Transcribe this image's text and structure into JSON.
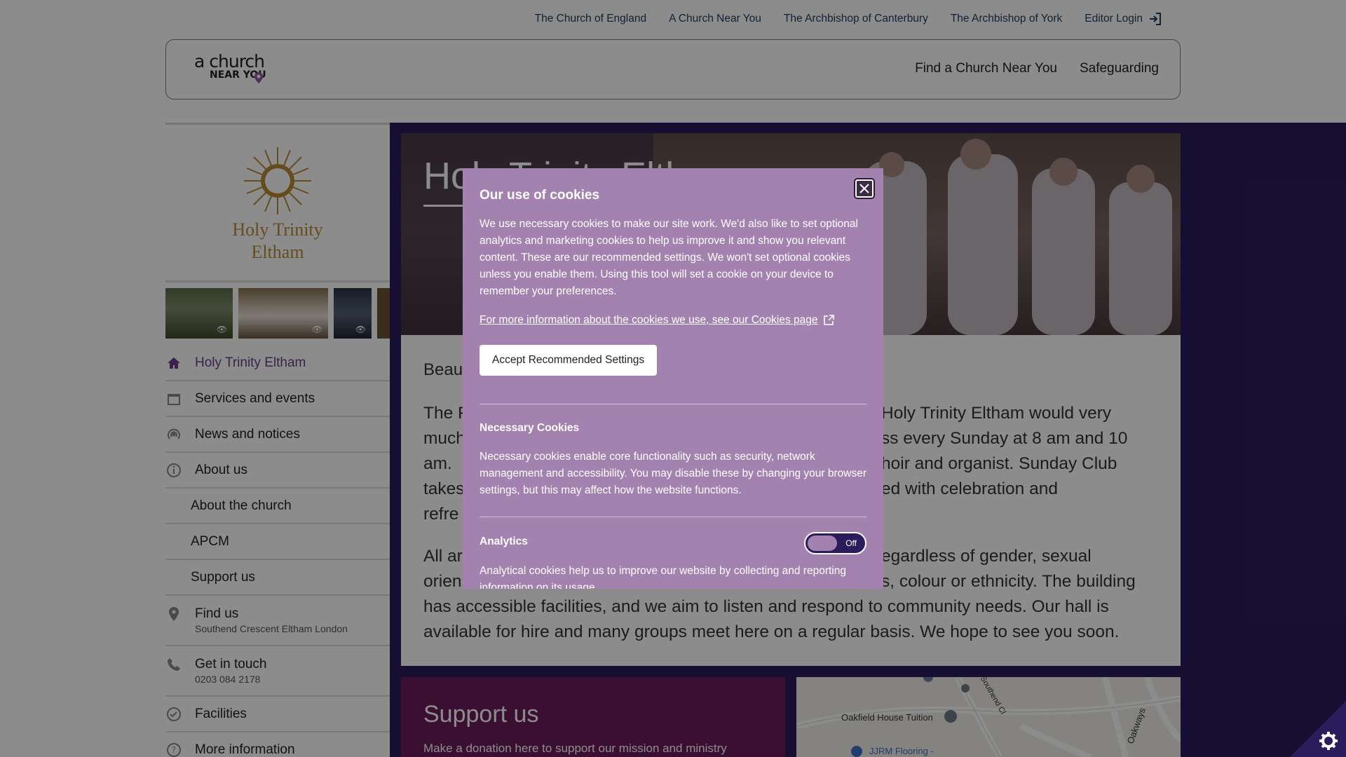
{
  "toplinks": [
    "The Church of England",
    "A Church Near You",
    "The Archbishop of Canterbury",
    "The Archbishop of York",
    "Editor Login"
  ],
  "header": {
    "logo_line1": "a church",
    "logo_line2": "NEAR YOU",
    "nav": [
      "Find a Church Near You",
      "Safeguarding"
    ]
  },
  "church": {
    "name_line1": "Holy Trinity",
    "name_line2": "Eltham"
  },
  "sidebar": {
    "items": [
      {
        "label": "Holy Trinity Eltham",
        "icon": "home-icon"
      },
      {
        "label": "Services and events",
        "icon": "calendar-icon"
      },
      {
        "label": "News and notices",
        "icon": "broadcast-icon"
      },
      {
        "label": "About us",
        "icon": "info-icon"
      },
      {
        "label": "About the church"
      },
      {
        "label": "APCM"
      },
      {
        "label": "Support us"
      },
      {
        "label": "Find us",
        "sub": "Southend Crescent Eltham London",
        "icon": "location-pin-icon"
      },
      {
        "label": "Get in touch",
        "sub": "0203 084 2178",
        "icon": "phone-icon"
      },
      {
        "label": "Facilities",
        "icon": "check-circle-icon"
      },
      {
        "label": "More information",
        "icon": "question-icon"
      }
    ]
  },
  "main": {
    "hero_title": "Holy Trinity Eltham",
    "lead": "Beau",
    "para1_lines": [
      "The F",
      "Holy Trinity Eltham would very",
      "much",
      "ss every Sunday at 8 am and 10",
      "am.",
      "hoir and organist.  Sunday Club",
      "takes",
      "ed with celebration and",
      "refre"
    ],
    "para2_left": [
      "All ar",
      "orien"
    ],
    "para2_right": [
      "egardless of gender, sexual",
      "s, colour or ethnicity. The building"
    ],
    "para2_full": [
      "has accessible facilities, and we aim to listen and respond to community needs. Our hall is",
      "available for hire and many groups meet here on a regular basis. We hope to see you soon."
    ],
    "support_title": "Support us",
    "support_text": "Make a donation here to support our mission and ministry",
    "map_labels": [
      "Oakfield House Tuition",
      "JJRM Flooring -",
      "Oakways",
      "Southend Cl"
    ]
  },
  "cookie": {
    "title": "Our use of cookies",
    "intro": "We use necessary cookies to make our site work. We'd also like to set optional analytics and marketing cookies to help us improve it and show you relevant content. These are our recommended settings. We won't set optional cookies unless you enable them. Using this tool will set a cookie on your device to remember your preferences.",
    "more_link": "For more information about the cookies we use, see our Cookies page",
    "accept_label": "Accept Recommended Settings",
    "necessary_title": "Necessary Cookies",
    "necessary_text": "Necessary cookies enable core functionality such as security, network management and accessibility. You may disable these by changing your browser settings, but this may affect how the website functions.",
    "analytics_title": "Analytics",
    "analytics_toggle": "Off",
    "analytics_text": "Analytical cookies help us to improve our website by collecting and reporting information on its usage."
  },
  "colors": {
    "accent_purple": "#2b1d5c",
    "modal_bg": "#a382b0",
    "support_bg": "#6b1d5c",
    "gold": "#b78a35"
  }
}
